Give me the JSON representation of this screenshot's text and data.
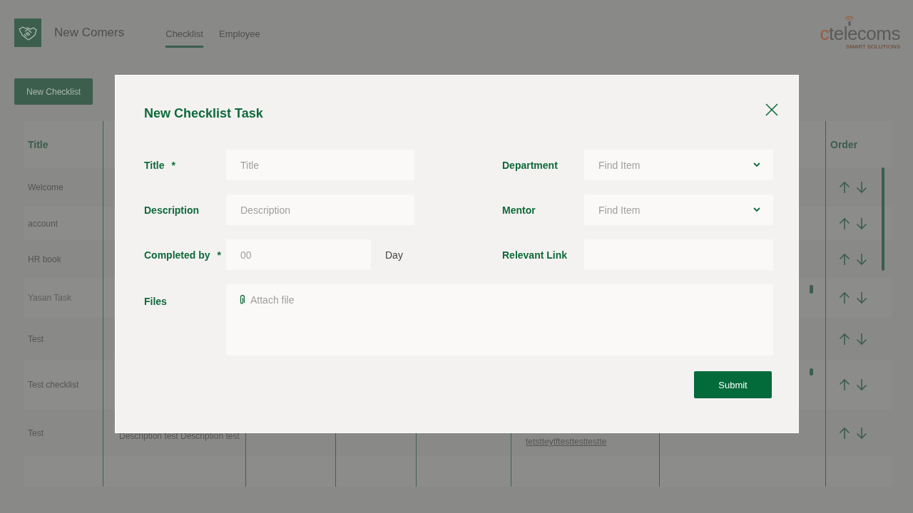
{
  "app": {
    "title": "New Comers"
  },
  "tabs": [
    {
      "label": "Checklist",
      "selected": true
    },
    {
      "label": "Employee",
      "selected": false
    }
  ],
  "brand": {
    "name": "ctelecoms",
    "tagline": "SMART SOLUTIONS"
  },
  "new_button": "New Checklist",
  "table": {
    "columns": [
      "Title",
      "Order"
    ],
    "rows": [
      {
        "title": "Welcome"
      },
      {
        "title": "account"
      },
      {
        "title": "HR book"
      },
      {
        "title": "Yasan Task"
      },
      {
        "title": "Test"
      },
      {
        "title": "Test checklist"
      },
      {
        "title": "Test",
        "column_2": "Description test Description test",
        "column_6": "tetstteytftesttesttestte"
      }
    ]
  },
  "dialog": {
    "title": "New Checklist Task",
    "fields": [
      {
        "kind": "text",
        "label": "Title",
        "required_mark": "*",
        "placeholder": "Title"
      },
      {
        "kind": "dropdown",
        "label": "Department",
        "placeholder": "Find Item"
      },
      {
        "kind": "text",
        "label": "Description",
        "placeholder": "Description"
      },
      {
        "kind": "dropdown",
        "label": "Mentor",
        "placeholder": "Find Item"
      },
      {
        "kind": "number",
        "label": "Completed by",
        "required_mark": "*",
        "placeholder": "00",
        "unit": "Day"
      },
      {
        "kind": "text",
        "label": "Relevant Link"
      },
      {
        "kind": "file",
        "label": "Files",
        "action": "Attach file"
      }
    ],
    "submit": "Submit"
  }
}
